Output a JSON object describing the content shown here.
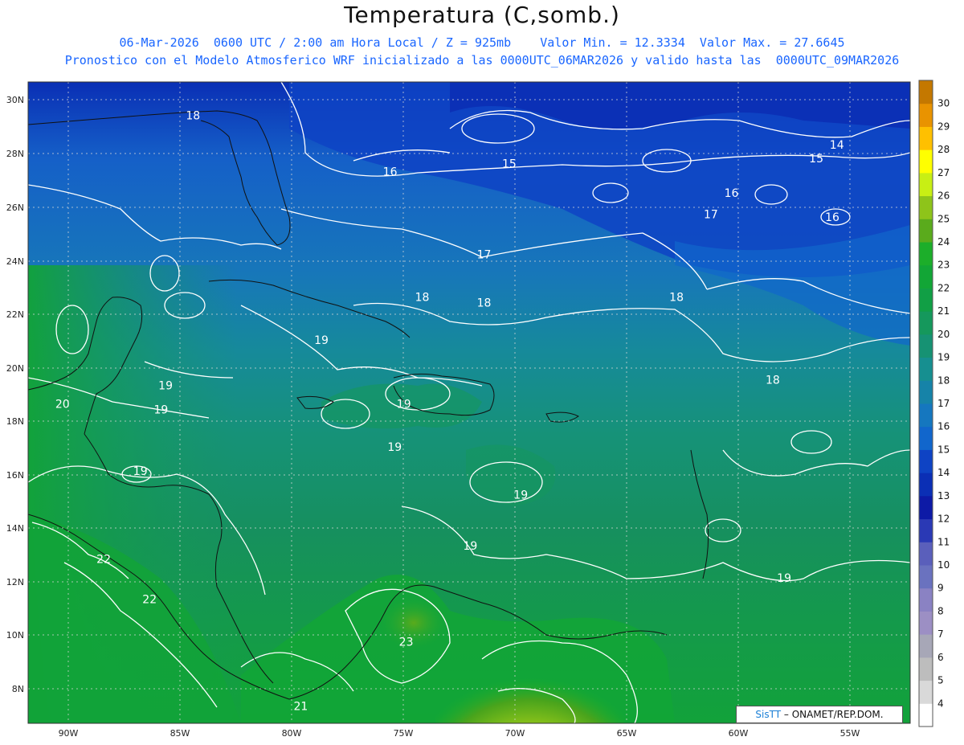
{
  "title": "Temperatura (C,somb.)",
  "subtitle_line1": "06-Mar-2026  0600 UTC / 2:00 am Hora Local / Z = 925mb    Valor Min. = 12.3334  Valor Max. = 27.6645",
  "subtitle_line2": "Pronostico con el Modelo Atmosferico WRF inicializado a las 0000UTC_06MAR2026 y valido hasta las  0000UTC_09MAR2026",
  "credit": {
    "logo": "SisTT",
    "text": "– ONAMET/REP.DOM."
  },
  "map": {
    "region": {
      "lon_min": -92,
      "lon_max": -53.5,
      "lat_min": 6.5,
      "lat_max": 30.5
    },
    "lat_ticks": [
      "8N",
      "10N",
      "12N",
      "14N",
      "16N",
      "18N",
      "20N",
      "22N",
      "24N",
      "26N",
      "28N",
      "30N"
    ],
    "lon_ticks": [
      "90W",
      "85W",
      "80W",
      "75W",
      "70W",
      "65W",
      "60W",
      "55W"
    ],
    "contour_labels": [
      {
        "text": "18",
        "lon": -84.8,
        "lat": 29.1
      },
      {
        "text": "16",
        "lon": -76.2,
        "lat": 27.0
      },
      {
        "text": "15",
        "lon": -71.0,
        "lat": 27.3
      },
      {
        "text": "14",
        "lon": -56.7,
        "lat": 28.0
      },
      {
        "text": "15",
        "lon": -57.6,
        "lat": 27.5
      },
      {
        "text": "16",
        "lon": -61.3,
        "lat": 26.2
      },
      {
        "text": "16",
        "lon": -56.9,
        "lat": 25.3
      },
      {
        "text": "17",
        "lon": -62.2,
        "lat": 25.4
      },
      {
        "text": "17",
        "lon": -72.1,
        "lat": 23.9
      },
      {
        "text": "18",
        "lon": -74.8,
        "lat": 22.3
      },
      {
        "text": "18",
        "lon": -72.1,
        "lat": 22.1
      },
      {
        "text": "18",
        "lon": -63.7,
        "lat": 22.3
      },
      {
        "text": "19",
        "lon": -79.2,
        "lat": 20.7
      },
      {
        "text": "19",
        "lon": -86.0,
        "lat": 19.0
      },
      {
        "text": "19",
        "lon": -86.2,
        "lat": 18.1
      },
      {
        "text": "20",
        "lon": -90.5,
        "lat": 18.3
      },
      {
        "text": "19",
        "lon": -75.6,
        "lat": 18.3
      },
      {
        "text": "18",
        "lon": -59.5,
        "lat": 19.2
      },
      {
        "text": "19",
        "lon": -76.0,
        "lat": 16.7
      },
      {
        "text": "19",
        "lon": -87.1,
        "lat": 15.8
      },
      {
        "text": "19",
        "lon": -70.5,
        "lat": 14.9
      },
      {
        "text": "19",
        "lon": -72.7,
        "lat": 13.0
      },
      {
        "text": "19",
        "lon": -59.0,
        "lat": 11.8
      },
      {
        "text": "22",
        "lon": -88.7,
        "lat": 12.5
      },
      {
        "text": "22",
        "lon": -86.7,
        "lat": 11.0
      },
      {
        "text": "23",
        "lon": -75.5,
        "lat": 9.4
      },
      {
        "text": "21",
        "lon": -80.1,
        "lat": 7.0
      }
    ]
  },
  "colorbar": {
    "levels": [
      "4",
      "5",
      "6",
      "7",
      "8",
      "9",
      "10",
      "11",
      "12",
      "13",
      "14",
      "15",
      "16",
      "17",
      "18",
      "19",
      "20",
      "21",
      "22",
      "23",
      "24",
      "25",
      "26",
      "27",
      "28",
      "29",
      "30"
    ],
    "colors": [
      "#ffffff",
      "#d9d9d9",
      "#bdbdbd",
      "#a7a7b7",
      "#9c8fc4",
      "#8a82c3",
      "#6a72bf",
      "#5a5fbb",
      "#2a39b5",
      "#0d1aa6",
      "#0b2fb5",
      "#0e43c4",
      "#1166cc",
      "#1577bf",
      "#1683a8",
      "#168f90",
      "#169273",
      "#15985c",
      "#119f45",
      "#12a636",
      "#1cae2a",
      "#5aab1c",
      "#8ec41a",
      "#c8ef14",
      "#ffff00",
      "#ffc000",
      "#e99300",
      "#c47800"
    ]
  }
}
